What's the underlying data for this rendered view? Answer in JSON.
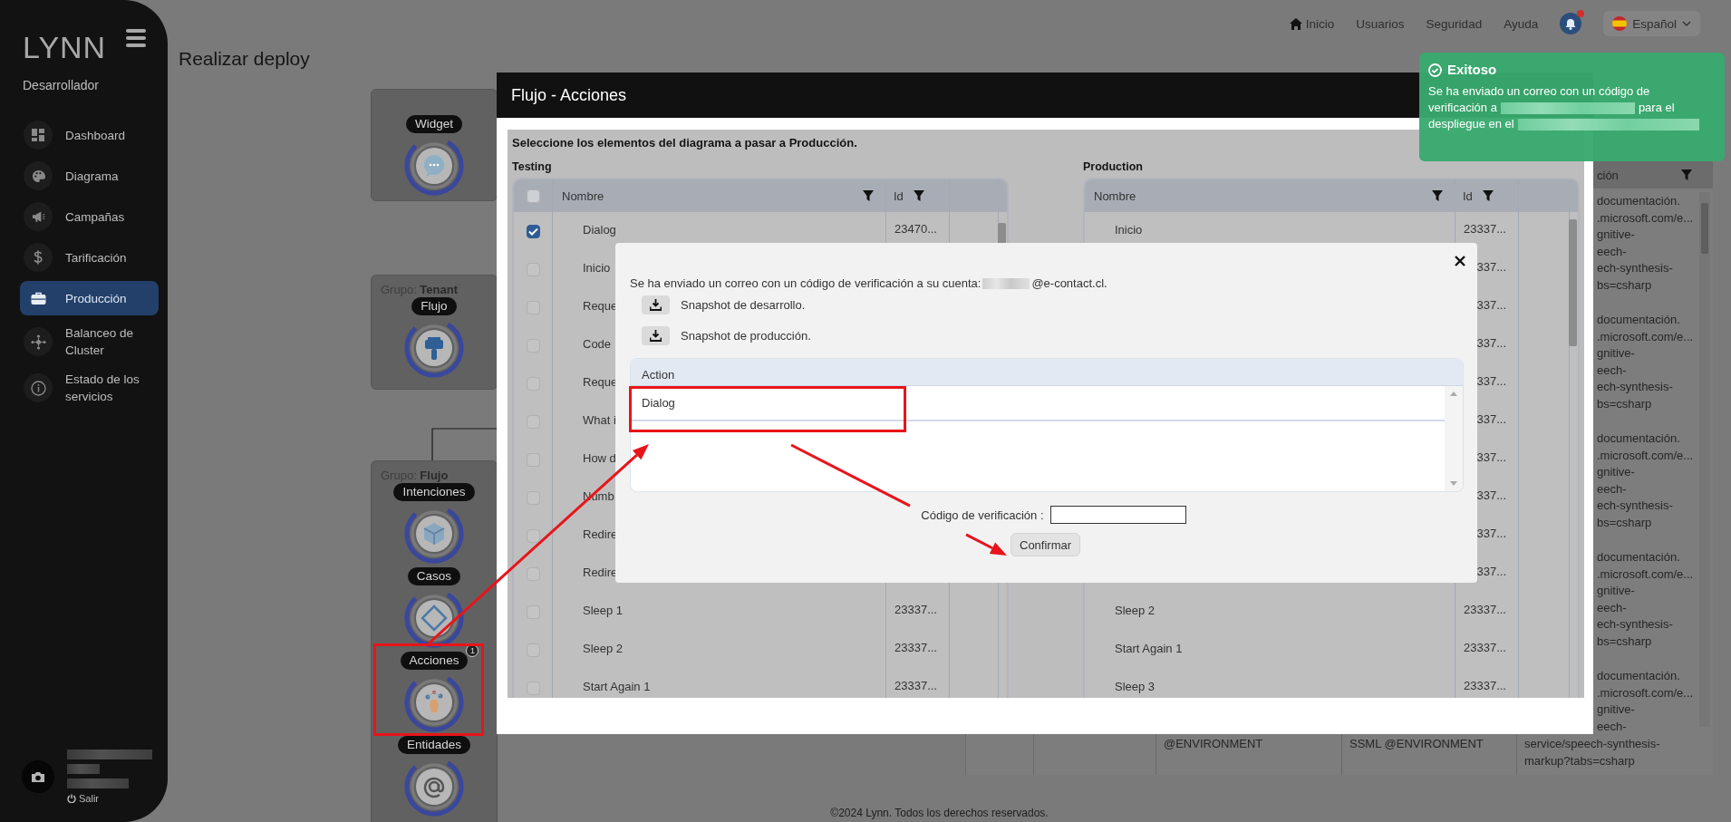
{
  "sidebar": {
    "logo": "LYNN",
    "role": "Desarrollador",
    "items": [
      {
        "label": "Dashboard",
        "selected": false
      },
      {
        "label": "Diagrama",
        "selected": false
      },
      {
        "label": "Campañas",
        "selected": false
      },
      {
        "label": "Tarificación",
        "selected": false
      },
      {
        "label": "Producción",
        "selected": true
      },
      {
        "label": "Balanceo de Cluster",
        "selected": false
      },
      {
        "label": "Estado de los servicios",
        "selected": false
      }
    ],
    "logout": "Salir"
  },
  "top_nav": {
    "links": [
      "Inicio",
      "Usuarios",
      "Seguridad",
      "Ayuda"
    ],
    "unread_notifications": true,
    "language": "Español"
  },
  "page_title": "Realizar deploy",
  "diagram": {
    "groups": [
      {
        "nodes": [
          {
            "label": "Widget"
          }
        ]
      },
      {
        "title": "Grupo: **Tenant**",
        "nodes": [
          {
            "label": "Flujo"
          }
        ]
      },
      {
        "title": "Grupo: **Flujo**",
        "nodes": [
          {
            "label": "Intenciones"
          },
          {
            "label": "Casos"
          },
          {
            "label": "Acciones",
            "badge": "1"
          },
          {
            "label": "Entidades"
          }
        ]
      }
    ]
  },
  "background_table": {
    "column_header": "ción",
    "cells": [
      [
        "documentación.",
        ".microsoft.com/e...",
        "gnitive-",
        "eech-",
        "ech-synthesis-",
        "bs=csharp"
      ],
      [
        "documentación.",
        ".microsoft.com/e...",
        "gnitive-",
        "eech-",
        "ech-synthesis-",
        "bs=csharp"
      ],
      [
        "documentación.",
        ".microsoft.com/e...",
        "gnitive-",
        "eech-",
        "ech-synthesis-",
        "bs=csharp"
      ],
      [
        "documentación.",
        ".microsoft.com/e...",
        "gnitive-",
        "eech-",
        "ech-synthesis-",
        "bs=csharp"
      ],
      [
        "documentación.",
        ".microsoft.com/e...",
        "gnitive-",
        "eech-"
      ]
    ],
    "bottom_row": [
      [
        "@ENVIRONMENT"
      ],
      [
        "SSML @ENVIRONMENT"
      ],
      [
        "service/speech-synthesis-",
        "markup?tabs=csharp"
      ]
    ]
  },
  "modal": {
    "title": "Flujo - Acciones",
    "instructions": "Seleccione los elementos del diagrama a pasar a Producción.",
    "testing": {
      "label": "Testing",
      "all_checked": false,
      "columns": [
        "Nombre",
        "Id"
      ],
      "rows": [
        {
          "name": "Dialog",
          "id": "23470...",
          "checked": true
        },
        {
          "name": "Inicio",
          "checked": false
        },
        {
          "name": "Reque",
          "checked": false
        },
        {
          "name": "Code",
          "checked": false
        },
        {
          "name": "Reque",
          "checked": false
        },
        {
          "name": "What i",
          "checked": false
        },
        {
          "name": "How d",
          "checked": false
        },
        {
          "name": "Numb",
          "checked": false
        },
        {
          "name": "Redire",
          "checked": false
        },
        {
          "name": "Redire",
          "checked": false
        },
        {
          "name": "Sleep 1",
          "id": "23337...",
          "checked": false
        },
        {
          "name": "Sleep 2",
          "id": "23337...",
          "checked": false
        },
        {
          "name": "Start Again 1",
          "id": "23337...",
          "checked": false
        }
      ]
    },
    "production": {
      "label": "Production",
      "columns": [
        "Nombre",
        "Id"
      ],
      "rows": [
        {
          "name": "Inicio",
          "id": "23337..."
        },
        {
          "id": "337..."
        },
        {
          "id": "337..."
        },
        {
          "id": "337..."
        },
        {
          "id": "337..."
        },
        {
          "id": "337..."
        },
        {
          "id": "337..."
        },
        {
          "id": "337..."
        },
        {
          "id": "337..."
        },
        {
          "id": "337..."
        },
        {
          "name": "Sleep 2",
          "id": "23337..."
        },
        {
          "name": "Start Again 1",
          "id": "23337..."
        },
        {
          "name": "Sleep 3",
          "id": "23337..."
        }
      ]
    }
  },
  "verification_dialog": {
    "message": [
      {
        "kind": "text",
        "text": "Se ha enviado un correo con un código de verificación a su cuenta:"
      },
      {
        "kind": "redacted"
      },
      {
        "kind": "text",
        "text": "@e-contact.cl."
      }
    ],
    "snapshots": [
      "Snapshot de desarrollo.",
      "Snapshot de producción."
    ],
    "action_table": {
      "column": "Action",
      "rows": [
        "Dialog"
      ]
    },
    "code_label": "Código de verificación :",
    "confirm": "Confirmar"
  },
  "toast": {
    "title": "Exitoso",
    "lines": [
      [
        {
          "kind": "text",
          "text": "Se ha enviado un correo con un código de"
        }
      ],
      [
        {
          "kind": "text",
          "text": "verificación a"
        },
        {
          "kind": "redacted"
        },
        {
          "kind": "text",
          "text": "para el"
        }
      ],
      [
        {
          "kind": "text",
          "text": "despliegue en el"
        },
        {
          "kind": "redacted"
        }
      ]
    ]
  },
  "footer": "©2024 Lynn. Todos los derechos reservados."
}
